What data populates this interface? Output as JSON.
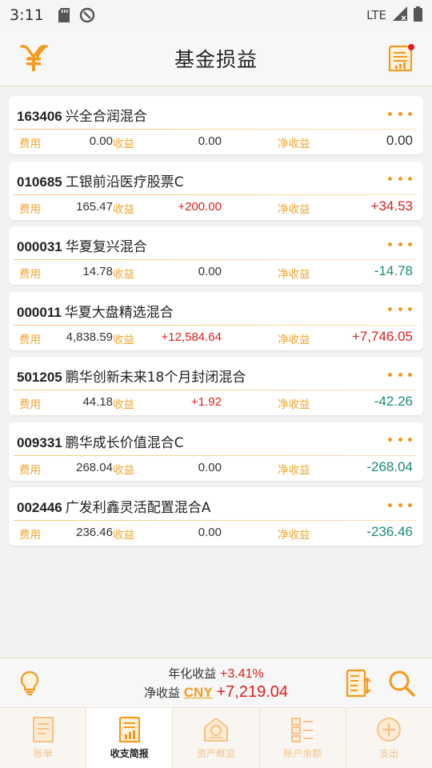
{
  "status": {
    "time": "3:11",
    "network": "LTE"
  },
  "header": {
    "title": "基金损益"
  },
  "labels": {
    "fee": "费用",
    "income": "收益",
    "net": "净收益"
  },
  "funds": [
    {
      "code": "163406",
      "name": "兴全合润混合",
      "fee": "0.00",
      "income": "0.00",
      "net": "0.00",
      "income_sign": "zero",
      "net_sign": "zero"
    },
    {
      "code": "010685",
      "name": "工银前沿医疗股票C",
      "fee": "165.47",
      "income": "+200.00",
      "net": "+34.53",
      "income_sign": "pos",
      "net_sign": "pos"
    },
    {
      "code": "000031",
      "name": "华夏复兴混合",
      "fee": "14.78",
      "income": "0.00",
      "net": "-14.78",
      "income_sign": "zero",
      "net_sign": "neg"
    },
    {
      "code": "000011",
      "name": "华夏大盘精选混合",
      "fee": "4,838.59",
      "income": "+12,584.64",
      "net": "+7,746.05",
      "income_sign": "pos",
      "net_sign": "pos"
    },
    {
      "code": "501205",
      "name": "鹏华创新未来18个月封闭混合",
      "fee": "44.18",
      "income": "+1.92",
      "net": "-42.26",
      "income_sign": "pos",
      "net_sign": "neg"
    },
    {
      "code": "009331",
      "name": "鹏华成长价值混合C",
      "fee": "268.04",
      "income": "0.00",
      "net": "-268.04",
      "income_sign": "zero",
      "net_sign": "neg"
    },
    {
      "code": "002446",
      "name": "广发利鑫灵活配置混合A",
      "fee": "236.46",
      "income": "0.00",
      "net": "-236.46",
      "income_sign": "zero",
      "net_sign": "neg"
    }
  ],
  "summary": {
    "annual_label": "年化收益",
    "annual_value": "+3.41%",
    "net_label": "净收益",
    "currency": "CNY",
    "net_value": "+7,219.04"
  },
  "tabs": [
    {
      "label": "账单",
      "icon": "bill-icon",
      "active": false
    },
    {
      "label": "收支简报",
      "icon": "report-icon",
      "active": true
    },
    {
      "label": "资产概览",
      "icon": "assets-icon",
      "active": false
    },
    {
      "label": "账户余额",
      "icon": "balance-icon",
      "active": false
    },
    {
      "label": "支出",
      "icon": "add-icon",
      "active": false
    }
  ],
  "colors": {
    "accent": "#f39a1e",
    "positive": "#e02020",
    "negative": "#1c8a7a",
    "label": "#f3a62e"
  }
}
